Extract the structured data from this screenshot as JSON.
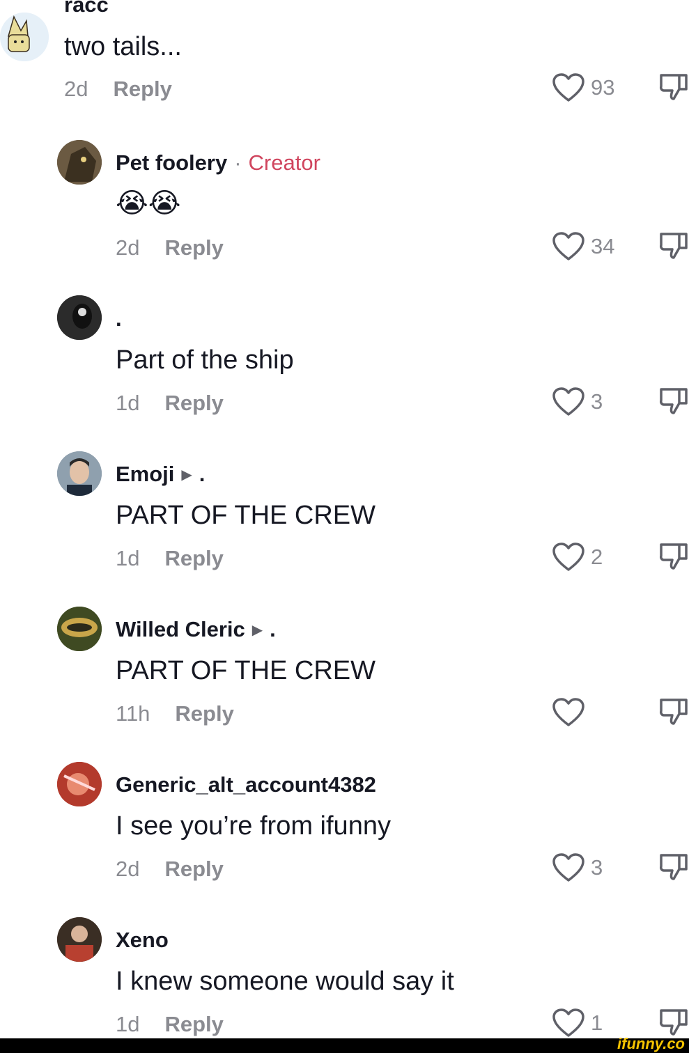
{
  "comments": [
    {
      "username": "racc",
      "text": "two tails...",
      "time": "2d",
      "reply": "Reply",
      "likes": "93"
    },
    {
      "username": "Pet foolery",
      "creator_sep": "·",
      "creator": "Creator",
      "text": "😭😭",
      "time": "2d",
      "reply": "Reply",
      "likes": "34"
    },
    {
      "username": ".",
      "text": "Part of the ship",
      "time": "1d",
      "reply": "Reply",
      "likes": "3"
    },
    {
      "username": "Emoji",
      "reply_to": ".",
      "text": "PART OF THE CREW",
      "time": "1d",
      "reply": "Reply",
      "likes": "2"
    },
    {
      "username": "Willed Cleric",
      "reply_to": ".",
      "text": "PART OF THE CREW",
      "time": "11h",
      "reply": "Reply",
      "likes": ""
    },
    {
      "username": "Generic_alt_account4382",
      "text": "I see you’re from ifunny",
      "time": "2d",
      "reply": "Reply",
      "likes": "3"
    },
    {
      "username": "Xeno",
      "text": "I knew someone would say it",
      "time": "1d",
      "reply": "Reply",
      "likes": "1"
    }
  ],
  "icons": {
    "like": "heart-outline-icon",
    "dislike": "thumbs-down-icon",
    "reply_arrow": "play-triangle-icon"
  },
  "watermark": "ifunny.co",
  "colors": {
    "creator": "#d0455e",
    "muted": "#8a8b91",
    "text": "#161823"
  }
}
